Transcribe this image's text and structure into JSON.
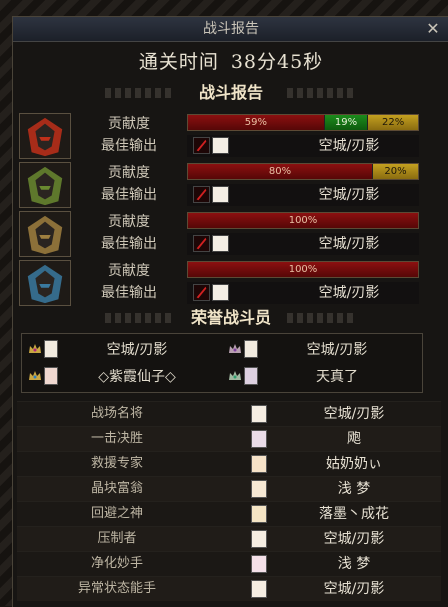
{
  "window": {
    "title": "战斗报告",
    "close_label": "✕"
  },
  "clear_time": {
    "label": "通关时间",
    "value": "38分45秒"
  },
  "section_battle": "战斗报告",
  "section_honor": "荣誉战斗员",
  "row_labels": {
    "contribution": "贡献度",
    "best_output": "最佳输出"
  },
  "colors": {
    "red": "#8c1010",
    "green": "#1c8c1c",
    "gold": "#c4a020"
  },
  "players": [
    {
      "portrait_icon": "fire-warrior-portrait-icon",
      "accent": "#c0301a",
      "segments": [
        {
          "pct": 59,
          "label": "59%",
          "color": "red"
        },
        {
          "pct": 19,
          "label": "19%",
          "color": "green"
        },
        {
          "pct": 22,
          "label": "22%",
          "color": "gold"
        }
      ],
      "best": "空城/刃影"
    },
    {
      "portrait_icon": "green-warrior-portrait-icon",
      "accent": "#6a8a30",
      "segments": [
        {
          "pct": 80,
          "label": "80%",
          "color": "red"
        },
        {
          "pct": 20,
          "label": "20%",
          "color": "gold"
        }
      ],
      "best": "空城/刃影"
    },
    {
      "portrait_icon": "bronze-warrior-portrait-icon",
      "accent": "#a08040",
      "segments": [
        {
          "pct": 100,
          "label": "100%",
          "color": "red"
        }
      ],
      "best": "空城/刃影"
    },
    {
      "portrait_icon": "blue-warrior-portrait-icon",
      "accent": "#3a7aa0",
      "segments": [
        {
          "pct": 100,
          "label": "100%",
          "color": "red"
        }
      ],
      "best": "空城/刃影"
    }
  ],
  "honor": [
    {
      "name": "空城/刃影"
    },
    {
      "name": "空城/刃影"
    },
    {
      "name": "◇紫霞仙子◇"
    },
    {
      "name": "天真了"
    }
  ],
  "awards": [
    {
      "title": "战场名将",
      "winner": "空城/刃影"
    },
    {
      "title": "一击决胜",
      "winner": "飑"
    },
    {
      "title": "救援专家",
      "winner": "姑奶奶ぃ"
    },
    {
      "title": "晶块富翁",
      "winner": "浅 梦"
    },
    {
      "title": "回避之神",
      "winner": "落墨丶成花"
    },
    {
      "title": "压制者",
      "winner": "空城/刃影"
    },
    {
      "title": "净化妙手",
      "winner": "浅 梦"
    },
    {
      "title": "异常状态能手",
      "winner": "空城/刃影"
    }
  ]
}
